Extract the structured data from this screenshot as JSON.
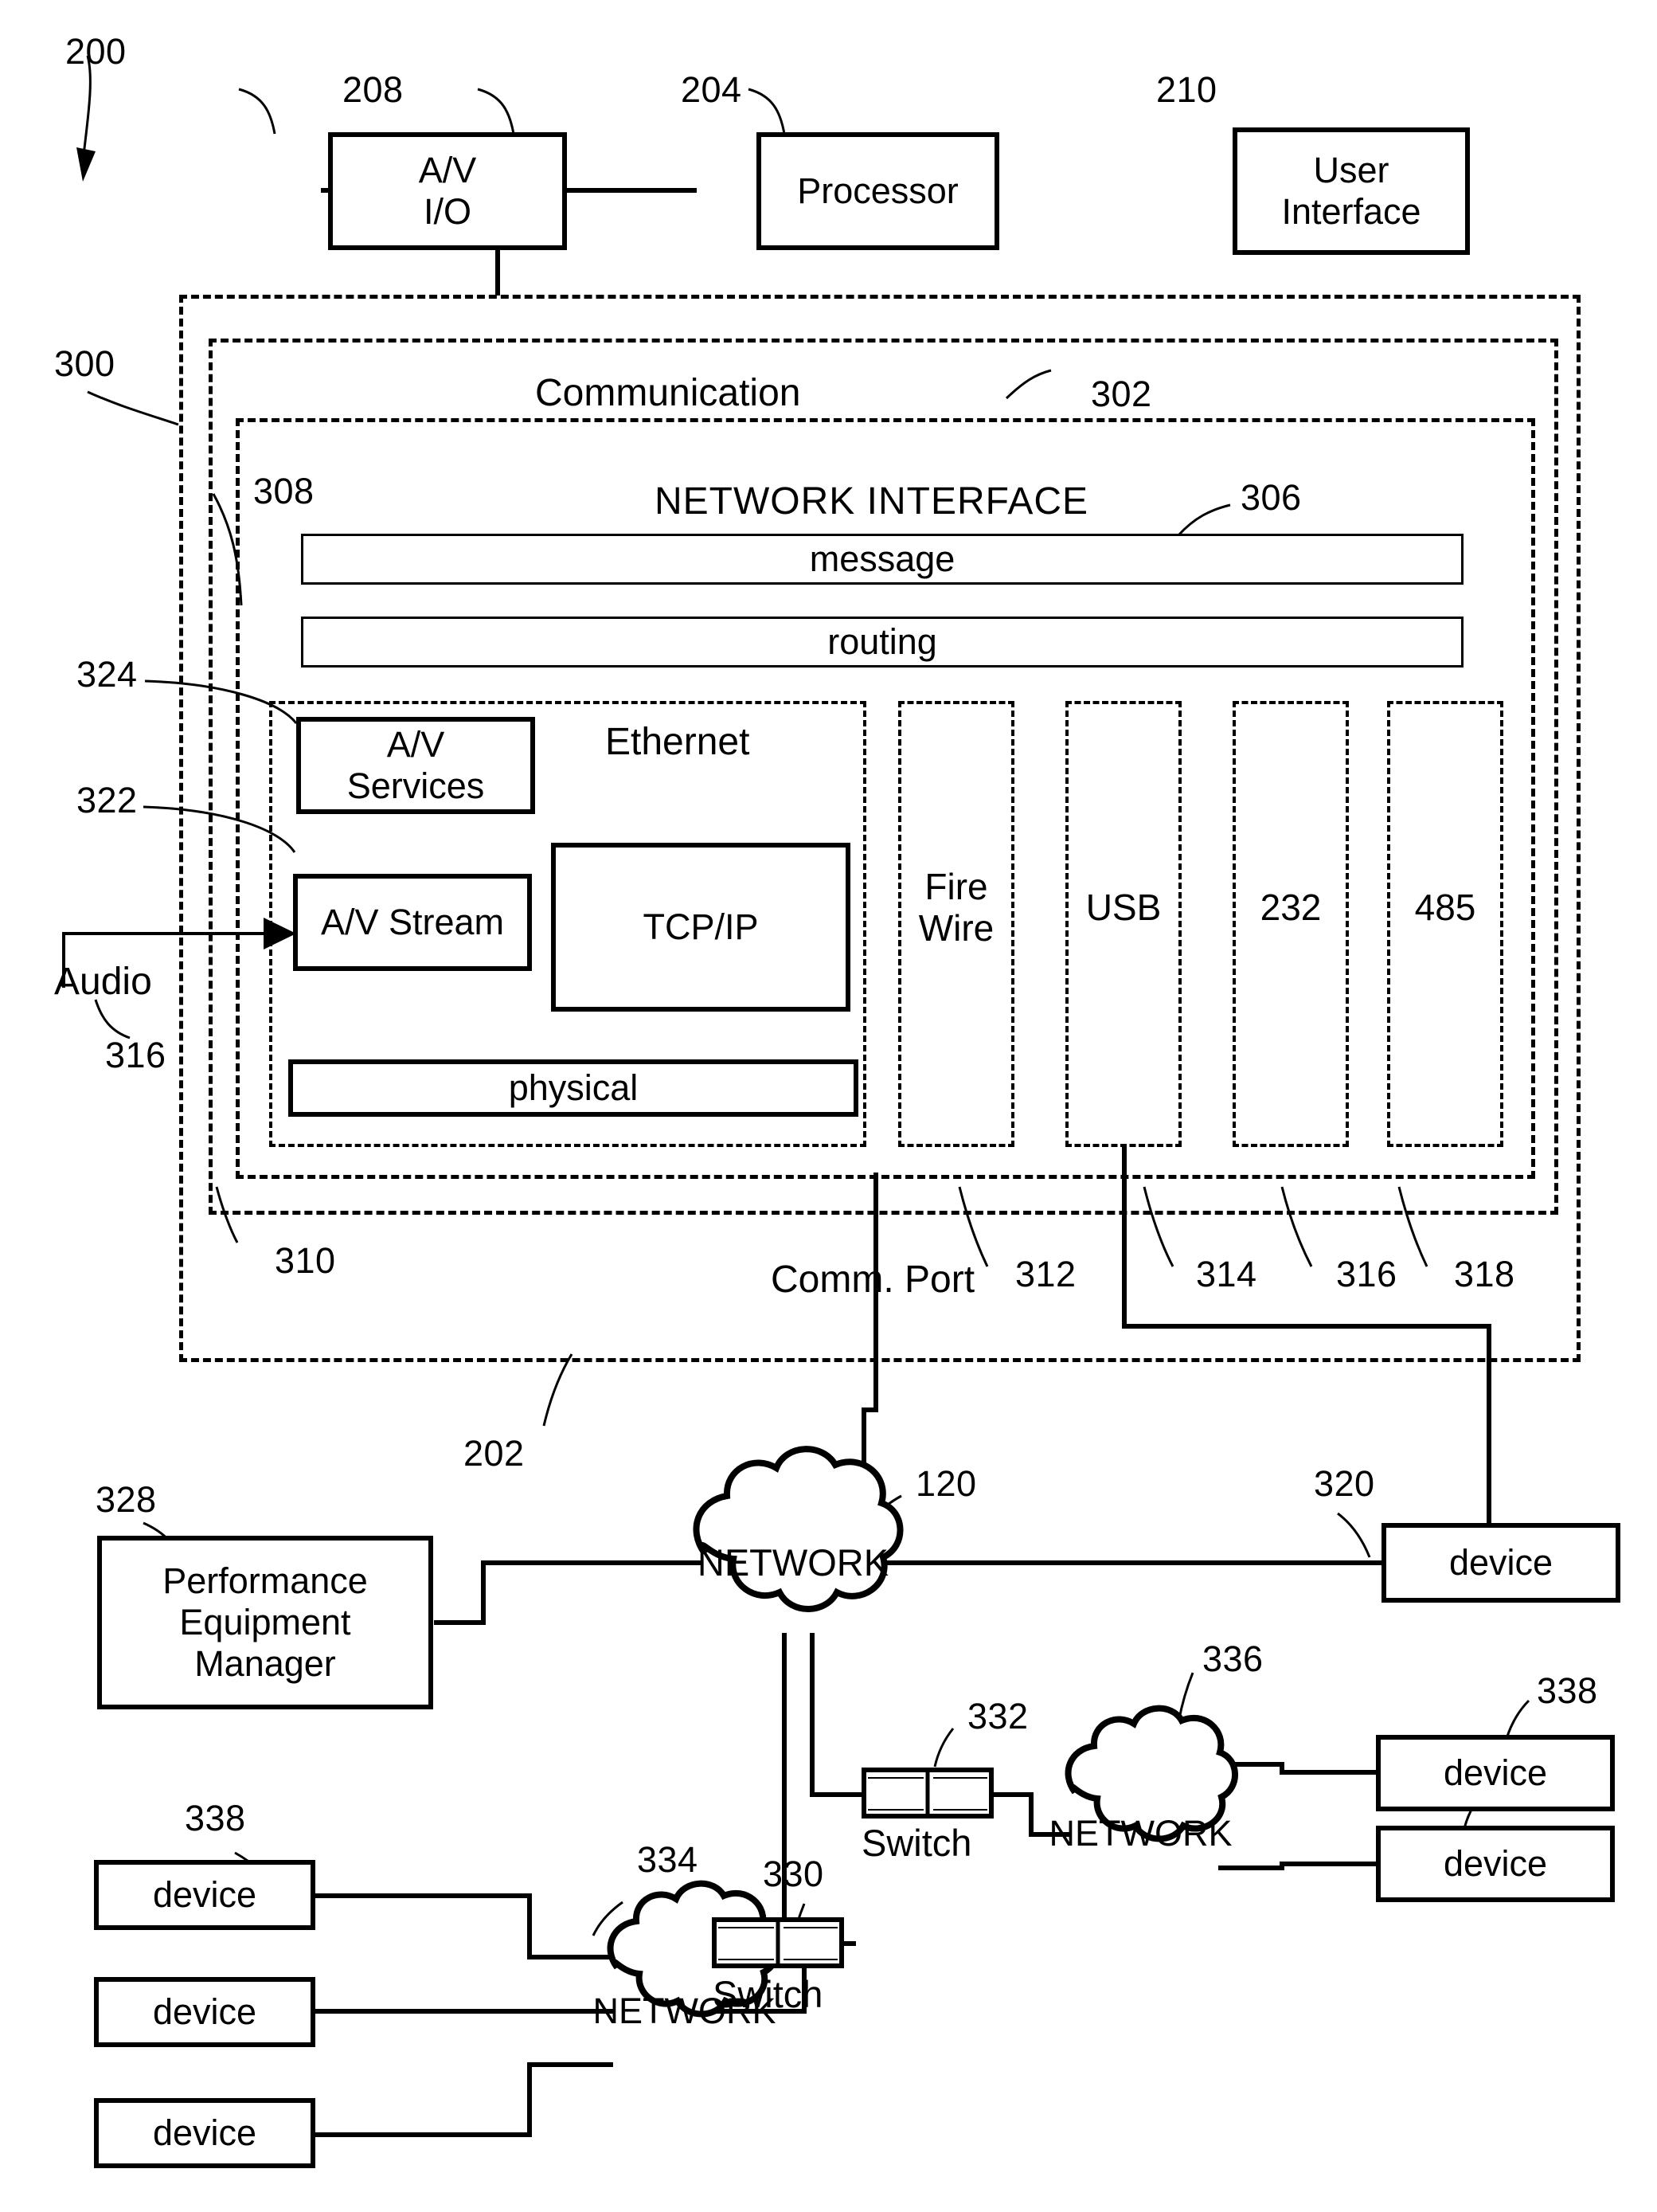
{
  "figure": {
    "number": "200",
    "title_ref": "200"
  },
  "top_row": {
    "av_io": {
      "ref": "208",
      "label": "A/V\nI/O"
    },
    "processor": {
      "ref": "204",
      "label": "Processor"
    },
    "user_interface": {
      "ref": "210",
      "label": "User\nInterface"
    }
  },
  "outer": {
    "ref_left": "300",
    "ref_bottom": "202"
  },
  "communication": {
    "label": "Communication",
    "ref": "302"
  },
  "network_interface": {
    "label": "NETWORK INTERFACE",
    "ref_left": "308",
    "ref_right": "306",
    "bars": [
      {
        "label": "message"
      },
      {
        "label": "routing"
      }
    ]
  },
  "ethernet": {
    "label": "Ethernet",
    "ref": "310",
    "blocks": [
      {
        "label": "A/V\nServices",
        "ref": "324"
      },
      {
        "label": "A/V Stream",
        "ref": "322"
      },
      {
        "label": "TCP/IP"
      },
      {
        "label": "physical"
      }
    ]
  },
  "audio_input": {
    "label": "Audio",
    "ref": "316"
  },
  "protocol_columns": [
    {
      "label": "Fire\nWire",
      "ref": "312"
    },
    {
      "label": "USB",
      "ref": "314"
    },
    {
      "label": "232",
      "ref": "316"
    },
    {
      "label": "485",
      "ref": "318"
    }
  ],
  "comm_port": {
    "label": "Comm. Port"
  },
  "bottom": {
    "pem": {
      "ref": "328",
      "label": "Performance\nEquipment\nManager"
    },
    "network_main": {
      "ref": "120",
      "label": "NETWORK"
    },
    "device_320": {
      "ref": "320",
      "label": "device"
    },
    "switch_332": {
      "ref": "332",
      "label": "Switch"
    },
    "network_336": {
      "ref": "336",
      "label": "NETWORK"
    },
    "device_338_right_top": {
      "ref": "338",
      "label": "device"
    },
    "device_338_right_bottom": {
      "label": "device"
    },
    "switch_330": {
      "ref": "330",
      "label": "Switch"
    },
    "network_334": {
      "ref": "334",
      "label": "NETWORK"
    },
    "device_338_left_top": {
      "ref": "338",
      "label": "device"
    },
    "device_left_mid": {
      "label": "device"
    },
    "device_left_bottom": {
      "label": "device"
    }
  },
  "colors": {
    "ink": "#000000",
    "paper": "#ffffff"
  }
}
